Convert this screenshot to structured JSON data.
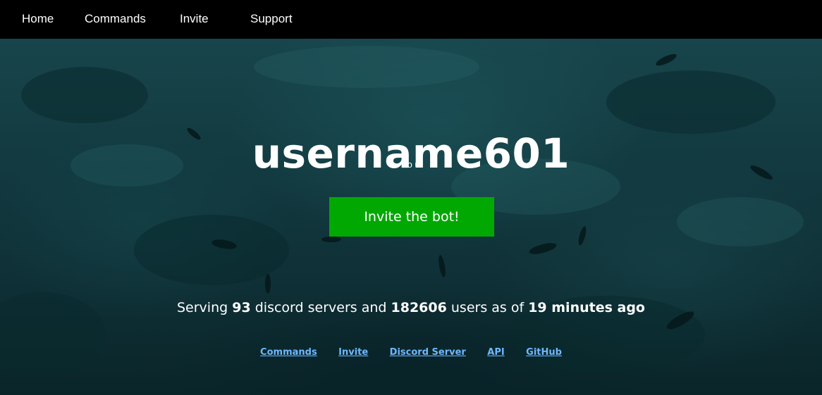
{
  "nav": {
    "items": [
      {
        "label": "Home"
      },
      {
        "label": "Commands"
      },
      {
        "label": "Invite"
      },
      {
        "label": "Support"
      }
    ]
  },
  "hero": {
    "title": "username601",
    "subtitle": "no u",
    "invite_button_label": "Invite the bot!"
  },
  "stats": {
    "prefix": "Serving",
    "servers_count": "93",
    "servers_text": "discord servers and",
    "users_count": "182606",
    "users_text": "users as of",
    "time_ago": "19 minutes ago"
  },
  "footer": {
    "links": [
      {
        "label": "Commands"
      },
      {
        "label": "Invite"
      },
      {
        "label": "Discord Server"
      },
      {
        "label": "API"
      },
      {
        "label": "GitHub"
      }
    ]
  },
  "colors": {
    "nav_bg": "#000000",
    "button_bg": "#02a802",
    "link": "#6fb8ff",
    "ocean_dark": "#0a2529",
    "ocean_light": "#17454b"
  }
}
